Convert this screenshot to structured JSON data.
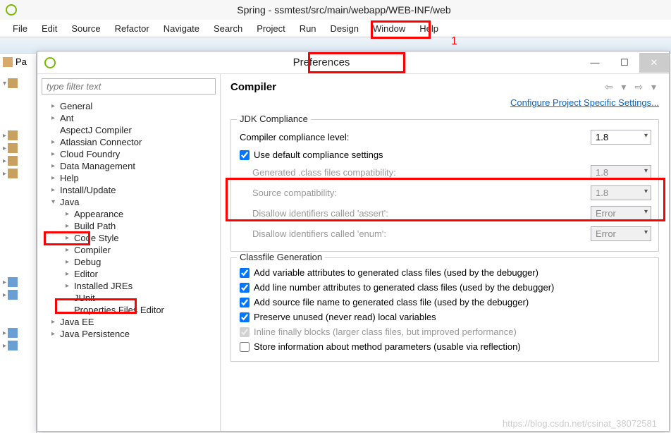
{
  "main": {
    "title": "Spring - ssmtest/src/main/webapp/WEB-INF/web",
    "menus": [
      "File",
      "Edit",
      "Source",
      "Refactor",
      "Navigate",
      "Search",
      "Project",
      "Run",
      "Design",
      "Window",
      "Help"
    ],
    "side_tab": "Pa"
  },
  "annotation": "1",
  "prefs": {
    "title": "Preferences",
    "filter_placeholder": "type filter text",
    "tree": {
      "lvl1": [
        {
          "label": "General",
          "exp": false
        },
        {
          "label": "Ant",
          "exp": false
        },
        {
          "label": "AspectJ Compiler",
          "leaf": true
        },
        {
          "label": "Atlassian Connector",
          "exp": false
        },
        {
          "label": "Cloud Foundry",
          "exp": false
        },
        {
          "label": "Data Management",
          "exp": false
        },
        {
          "label": "Help",
          "exp": false
        },
        {
          "label": "Install/Update",
          "exp": false
        },
        {
          "label": "Java",
          "exp": true,
          "children": [
            {
              "label": "Appearance",
              "exp": false
            },
            {
              "label": "Build Path",
              "exp": false
            },
            {
              "label": "Code Style",
              "exp": false
            },
            {
              "label": "Compiler",
              "exp": false
            },
            {
              "label": "Debug",
              "exp": false
            },
            {
              "label": "Editor",
              "exp": false
            },
            {
              "label": "Installed JREs",
              "exp": false
            },
            {
              "label": "JUnit",
              "leaf": true
            },
            {
              "label": "Properties Files Editor",
              "leaf": true
            }
          ]
        },
        {
          "label": "Java EE",
          "exp": false
        },
        {
          "label": "Java Persistence",
          "exp": false
        }
      ]
    },
    "right": {
      "heading": "Compiler",
      "config_link": "Configure Project Specific Settings...",
      "group1_title": "JDK Compliance",
      "compliance_label": "Compiler compliance level:",
      "compliance_value": "1.8",
      "use_default_label": "Use default compliance settings",
      "gen_class_label": "Generated .class files compatibility:",
      "gen_class_value": "1.8",
      "source_compat_label": "Source compatibility:",
      "source_compat_value": "1.8",
      "assert_label": "Disallow identifiers called 'assert':",
      "assert_value": "Error",
      "enum_label": "Disallow identifiers called 'enum':",
      "enum_value": "Error",
      "group2_title": "Classfile Generation",
      "cf1": "Add variable attributes to generated class files (used by the debugger)",
      "cf2": "Add line number attributes to generated class files (used by the debugger)",
      "cf3": "Add source file name to generated class file (used by the debugger)",
      "cf4": "Preserve unused (never read) local variables",
      "cf5": "Inline finally blocks (larger class files, but improved performance)",
      "cf6": "Store information about method parameters (usable via reflection)"
    }
  },
  "watermark": "https://blog.csdn.net/csinat_38072581"
}
